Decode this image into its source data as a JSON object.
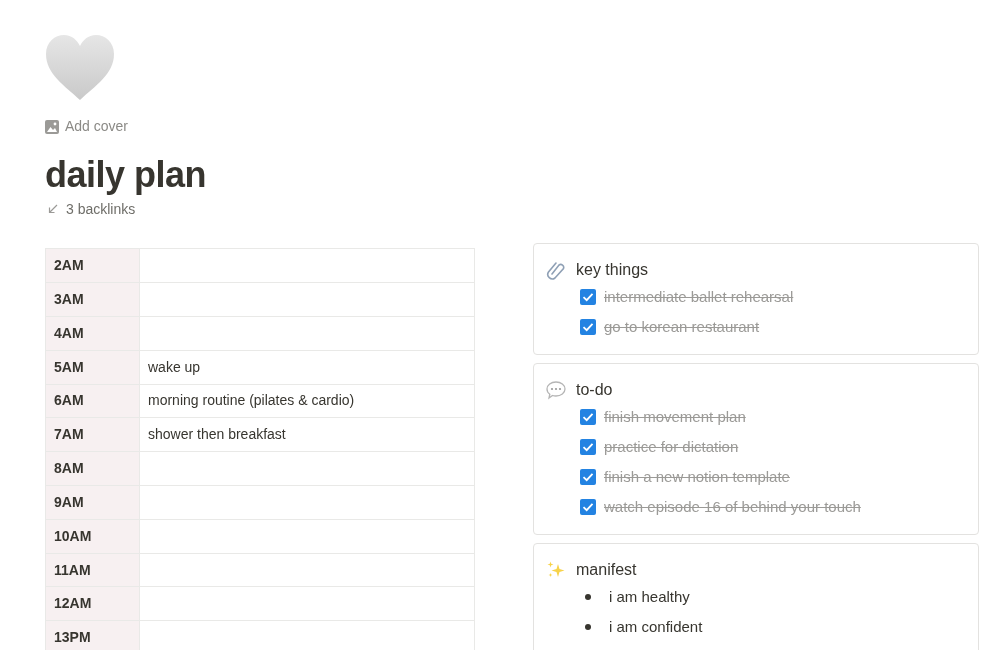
{
  "page": {
    "add_cover": "Add cover",
    "title": "daily plan",
    "backlinks": "3 backlinks"
  },
  "schedule": [
    {
      "time": "2AM"
    },
    {
      "time": "3AM"
    },
    {
      "time": "4AM"
    },
    {
      "time": "5AM",
      "plan": "wake up"
    },
    {
      "time": "6AM",
      "plan": "morning routine (pilates & cardio)"
    },
    {
      "time": "7AM",
      "plan": "shower then breakfast"
    },
    {
      "time": "8AM"
    },
    {
      "time": "9AM"
    },
    {
      "time": "10AM"
    },
    {
      "time": "11AM"
    },
    {
      "time": "12AM"
    },
    {
      "time": "13PM"
    }
  ],
  "sections": [
    {
      "kind": "checklist",
      "title": "key things",
      "items": [
        {
          "text": "intermediate ballet rehearsal",
          "checked": true
        },
        {
          "text": "go to korean restaurant",
          "checked": true
        }
      ]
    },
    {
      "kind": "checklist",
      "title": "to-do",
      "items": [
        {
          "text": "finish movement plan",
          "checked": true
        },
        {
          "text": "practice for dictation",
          "checked": true
        },
        {
          "text": "finish a new notion template",
          "checked": true
        },
        {
          "text": "watch episode 16 of behind your touch",
          "checked": true
        }
      ]
    },
    {
      "kind": "bullets",
      "title": "manifest",
      "items": [
        {
          "text": "i am healthy"
        },
        {
          "text": "i am confident"
        }
      ]
    }
  ]
}
